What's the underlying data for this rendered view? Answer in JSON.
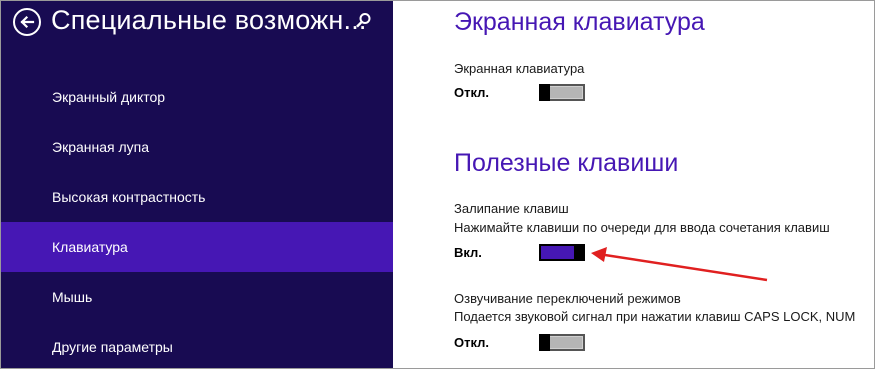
{
  "sidebar": {
    "title": "Специальные возможн...",
    "items": [
      {
        "label": "Экранный диктор",
        "active": false
      },
      {
        "label": "Экранная лупа",
        "active": false
      },
      {
        "label": "Высокая контрастность",
        "active": false
      },
      {
        "label": "Клавиатура",
        "active": true
      },
      {
        "label": "Мышь",
        "active": false
      },
      {
        "label": "Другие параметры",
        "active": false
      }
    ]
  },
  "main": {
    "osk_section": {
      "title": "Экранная клавиатура",
      "setting_label": "Экранная клавиатура",
      "state_label": "Откл.",
      "enabled": false
    },
    "keys_section": {
      "title": "Полезные клавиши",
      "sticky_label": "Залипание клавиш",
      "sticky_description": "Нажимайте клавиши по очереди для ввода сочетания клавиш",
      "sticky_state": "Вкл.",
      "sticky_enabled": true,
      "toggle_sound_label": "Озвучивание переключений режимов",
      "toggle_sound_description": "Подается звуковой сигнал при нажатии клавиш CAPS LOCK, NUM",
      "toggle_sound_state": "Откл.",
      "toggle_sound_enabled": false
    }
  },
  "colors": {
    "sidebar_bg": "#180b52",
    "accent": "#4617b4",
    "annotation_arrow": "#e02020"
  },
  "icons": [
    "back-arrow-icon",
    "search-icon",
    "red-annotation-arrow"
  ]
}
